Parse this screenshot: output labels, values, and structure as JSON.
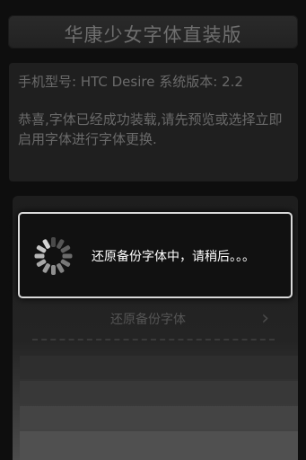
{
  "app": {
    "title": "华康少女字体直装版"
  },
  "info": {
    "device_line": "手机型号: HTC Desire  系统版本: 2.2",
    "message": "恭喜,字体已经成功装载,请先预览或选择立即启用字体进行字体更换."
  },
  "list": {
    "restore_label": "还原备份字体",
    "chevron": "›"
  },
  "dialog": {
    "message": "还原备份字体中，请稍后。。。"
  }
}
